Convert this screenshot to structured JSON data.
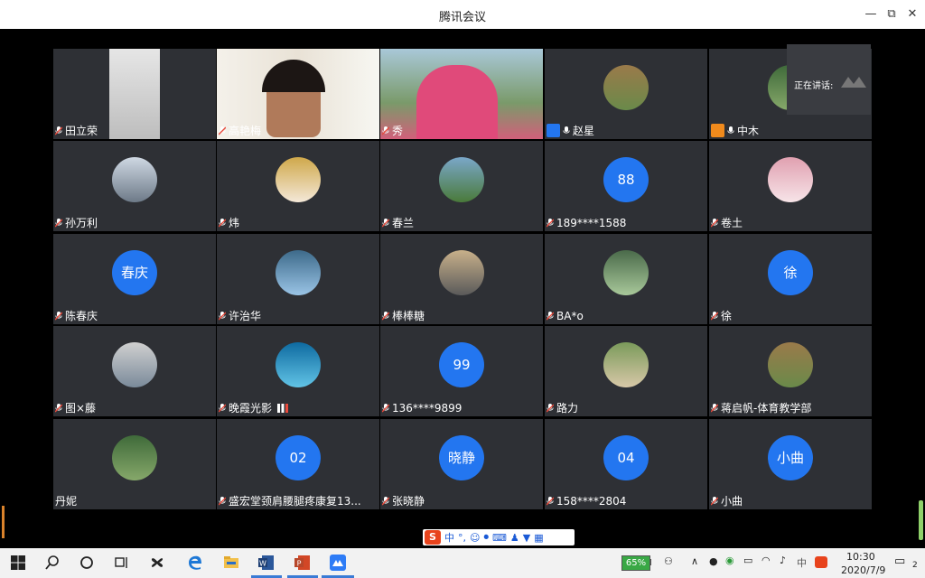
{
  "window": {
    "title": "腾讯会议",
    "min_glyph": "—",
    "restore_glyph": "⧉",
    "close_glyph": "✕"
  },
  "speaking": {
    "label": "正在讲话:"
  },
  "participants": [
    {
      "name": "田立荣",
      "type": "video"
    },
    {
      "name": "高艳梅",
      "type": "video"
    },
    {
      "name": "秀",
      "type": "video"
    },
    {
      "name": "赵星",
      "type": "photo",
      "role": "host"
    },
    {
      "name": "中木",
      "type": "photo",
      "role": "cohost"
    },
    {
      "name": "孙万利",
      "type": "photo"
    },
    {
      "name": "炜",
      "type": "photo"
    },
    {
      "name": "春兰",
      "type": "photo"
    },
    {
      "name": "189****1588",
      "type": "text",
      "avatar_text": "88"
    },
    {
      "name": "卷土",
      "type": "photo"
    },
    {
      "name": "陈春庆",
      "type": "text",
      "avatar_text": "春庆"
    },
    {
      "name": "许治华",
      "type": "photo"
    },
    {
      "name": "棒棒糖",
      "type": "photo"
    },
    {
      "name": "BA*o",
      "type": "photo"
    },
    {
      "name": "徐",
      "type": "text",
      "avatar_text": "徐"
    },
    {
      "name": "图×藤",
      "type": "photo"
    },
    {
      "name": "晚霞光影",
      "type": "photo",
      "signal": true
    },
    {
      "name": "136****9899",
      "type": "text",
      "avatar_text": "99"
    },
    {
      "name": "路力",
      "type": "photo"
    },
    {
      "name": "蒋启帆-体育教学部",
      "type": "photo"
    },
    {
      "name": "丹妮",
      "type": "photo",
      "no_mic": true
    },
    {
      "name": "盛宏堂颈肩腰腿疼康复13...",
      "type": "text",
      "avatar_text": "02"
    },
    {
      "name": "张晓静",
      "type": "text",
      "avatar_text": "晓静"
    },
    {
      "name": "158****2804",
      "type": "text",
      "avatar_text": "04"
    },
    {
      "name": "小曲",
      "type": "text",
      "avatar_text": "小曲"
    }
  ],
  "ime_toolbar": {
    "s_glyph": "S",
    "lang": "中",
    "punct": "°,"
  },
  "taskbar": {
    "battery": "65%",
    "ime_lang": "中",
    "time": "10:30",
    "date": "2020/7/9",
    "notification_count": "2"
  },
  "colors": {
    "tile_bg": "#2e3035",
    "avatar_blue": "#2376f0",
    "mic_red": "#e84a3c"
  }
}
